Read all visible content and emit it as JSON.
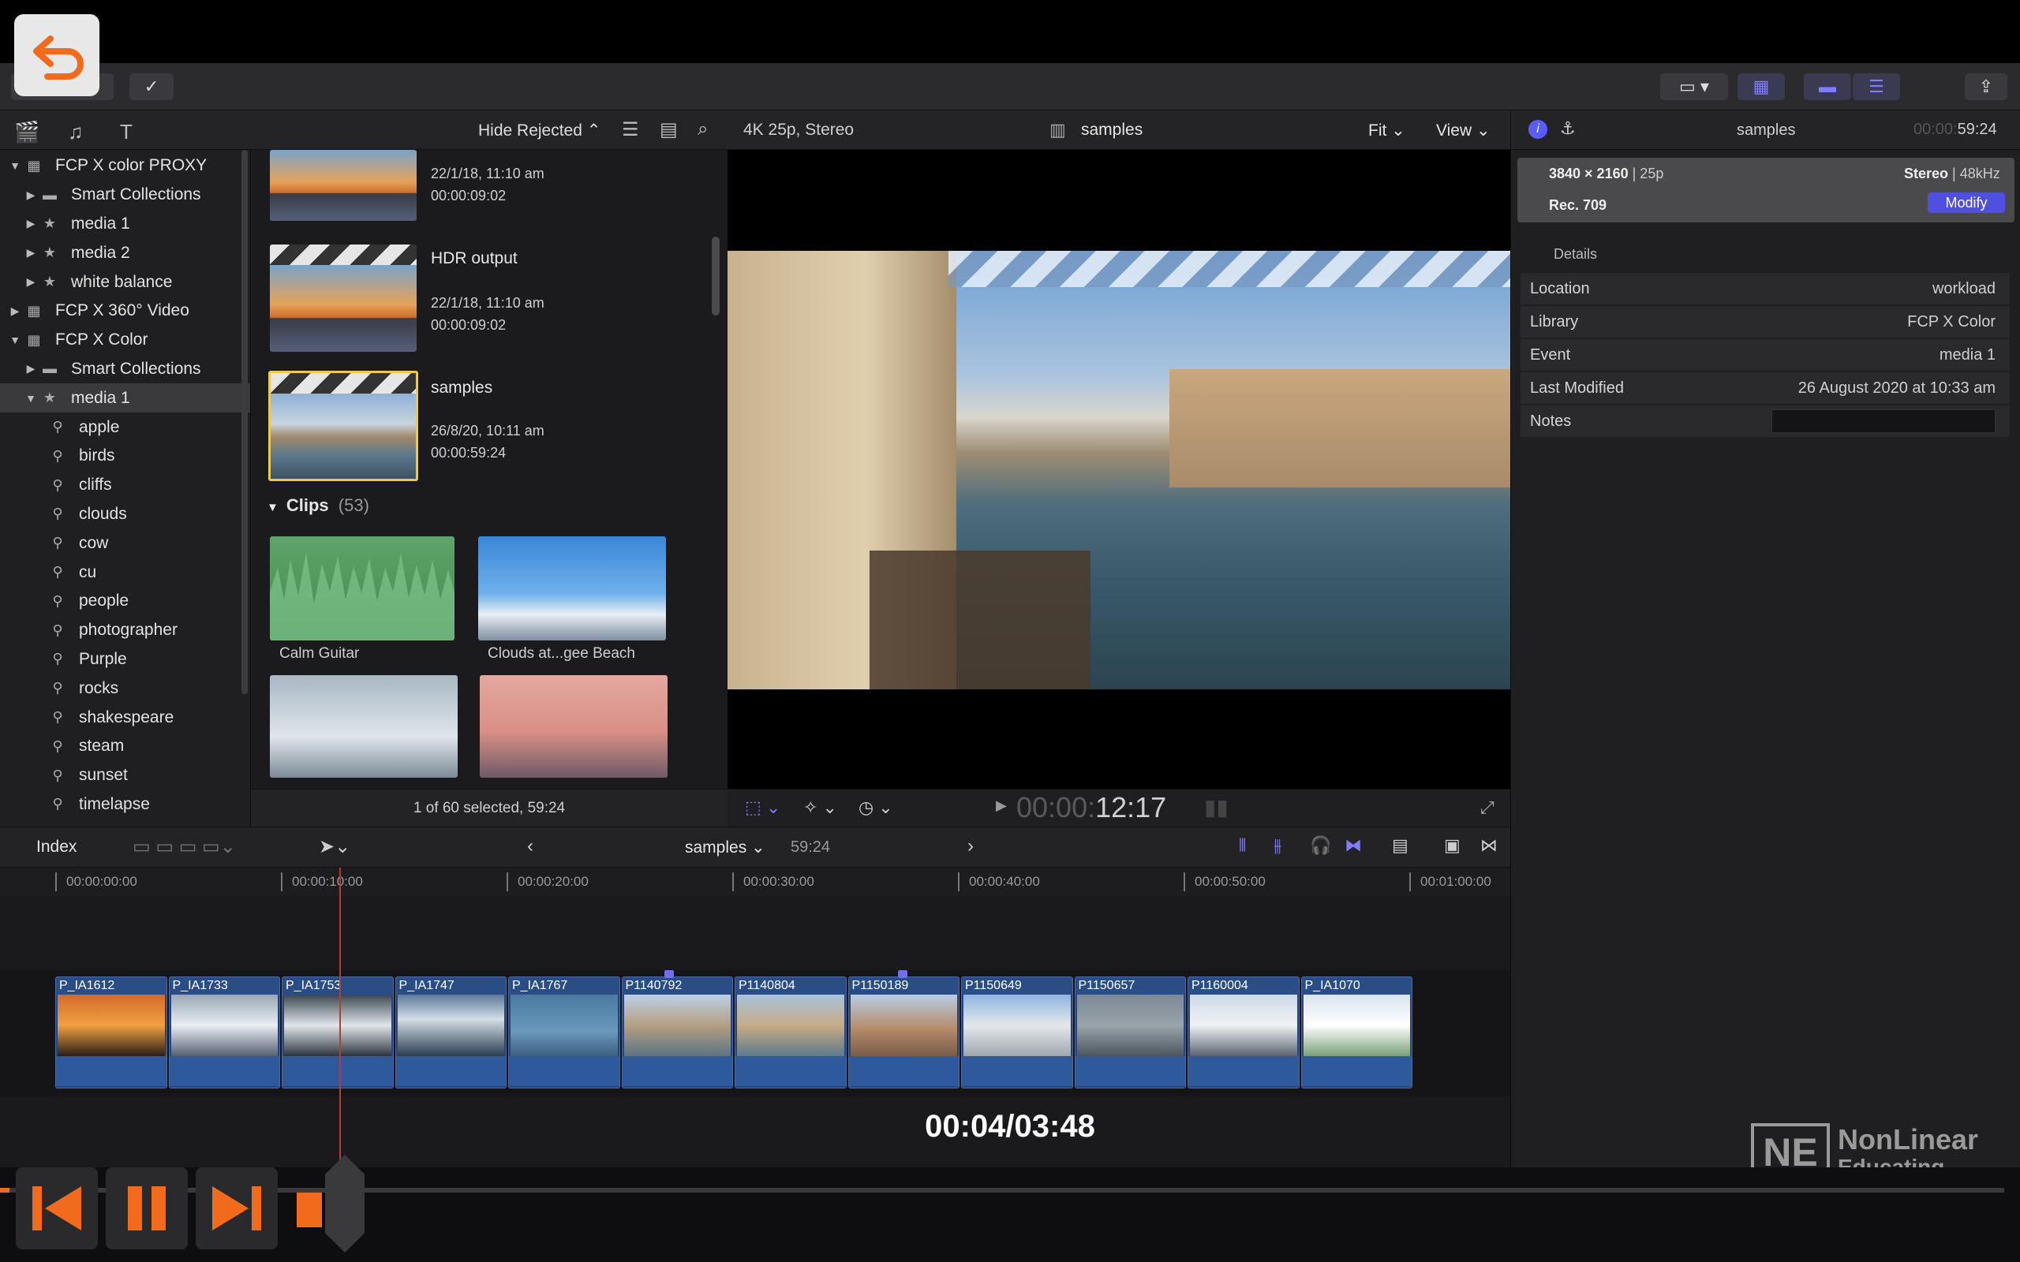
{
  "toolbar": {
    "back_icon": "undo-arrow-icon",
    "check_icon": "checkmark-icon"
  },
  "browser": {
    "filter_label": "Hide Rejected",
    "top_clip": {
      "date": "22/1/18, 11:10 am",
      "duration": "00:00:09:02"
    },
    "hdr_clip": {
      "name": "HDR output",
      "date": "22/1/18, 11:10 am",
      "duration": "00:00:09:02"
    },
    "samples_clip": {
      "name": "samples",
      "date": "26/8/20, 10:11 am",
      "duration": "00:00:59:24"
    },
    "clips_header": "Clips",
    "clips_count": "(53)",
    "clips": [
      "Calm Guitar",
      "Clouds at...gee Beach"
    ],
    "status": "1 of 60 selected, 59:24"
  },
  "library": {
    "items": [
      {
        "label": "FCP X color PROXY",
        "level": 0,
        "tri": "▼",
        "icon": "library-icon"
      },
      {
        "label": "Smart Collections",
        "level": 1,
        "tri": "▶",
        "icon": "folder-icon"
      },
      {
        "label": "media 1",
        "level": 1,
        "tri": "▶",
        "icon": "event-icon"
      },
      {
        "label": "media 2",
        "level": 1,
        "tri": "▶",
        "icon": "event-icon"
      },
      {
        "label": "white balance",
        "level": 1,
        "tri": "▶",
        "icon": "event-icon"
      },
      {
        "label": "FCP X 360° Video",
        "level": 0,
        "tri": "▶",
        "icon": "library-icon"
      },
      {
        "label": "FCP X Color",
        "level": 0,
        "tri": "▼",
        "icon": "library-icon"
      },
      {
        "label": "Smart Collections",
        "level": 1,
        "tri": "▶",
        "icon": "folder-icon"
      },
      {
        "label": "media 1",
        "level": 1,
        "tri": "▼",
        "icon": "event-icon",
        "selected": true
      },
      {
        "label": "apple",
        "level": 2,
        "icon": "keyword-icon"
      },
      {
        "label": "birds",
        "level": 2,
        "icon": "keyword-icon"
      },
      {
        "label": "cliffs",
        "level": 2,
        "icon": "keyword-icon"
      },
      {
        "label": "clouds",
        "level": 2,
        "icon": "keyword-icon"
      },
      {
        "label": "cow",
        "level": 2,
        "icon": "keyword-icon"
      },
      {
        "label": "cu",
        "level": 2,
        "icon": "keyword-icon"
      },
      {
        "label": "people",
        "level": 2,
        "icon": "keyword-icon"
      },
      {
        "label": "photographer",
        "level": 2,
        "icon": "keyword-icon"
      },
      {
        "label": "Purple",
        "level": 2,
        "icon": "keyword-icon"
      },
      {
        "label": "rocks",
        "level": 2,
        "icon": "keyword-icon"
      },
      {
        "label": "shakespeare",
        "level": 2,
        "icon": "keyword-icon"
      },
      {
        "label": "steam",
        "level": 2,
        "icon": "keyword-icon"
      },
      {
        "label": "sunset",
        "level": 2,
        "icon": "keyword-icon"
      },
      {
        "label": "timelapse",
        "level": 2,
        "icon": "keyword-icon"
      }
    ]
  },
  "viewer": {
    "format": "4K 25p, Stereo",
    "title": "samples",
    "fit": "Fit",
    "view": "View",
    "tc_dim": "00:00:",
    "tc_main": "12:17"
  },
  "inspector": {
    "title": "samples",
    "tc_dim": "00:00:",
    "tc_main": "59:24",
    "resolution": "3840 × 2160",
    "rate": "| 25p",
    "audio": "Stereo",
    "audio_rate": "| 48kHz",
    "colorspace": "Rec. 709",
    "modify": "Modify",
    "section": "Details",
    "details": [
      {
        "label": "Location",
        "value": "workload"
      },
      {
        "label": "Library",
        "value": "FCP X Color"
      },
      {
        "label": "Event",
        "value": "media 1"
      },
      {
        "label": "Last Modified",
        "value": "26 August 2020 at 10:33 am"
      },
      {
        "label": "Notes",
        "value": ""
      }
    ]
  },
  "timeline": {
    "index": "Index",
    "project": "samples",
    "duration": "59:24",
    "ruler": [
      "00:00:00:00",
      "00:00:10:00",
      "00:00:20:00",
      "00:00:30:00",
      "00:00:40:00",
      "00:00:50:00",
      "00:01:00:00"
    ],
    "clips": [
      "P_IA1612",
      "P_IA1733",
      "P_IA1753",
      "P_IA1747",
      "P_IA1767",
      "P1140792",
      "P1140804",
      "P1150189",
      "P1150649",
      "P1150657",
      "P1160004",
      "P_IA1070"
    ]
  },
  "player": {
    "time": "00:04/03:48",
    "logo_line1": "NonLinear",
    "logo_line2": "Educating Inc.",
    "logo_mark": "NE"
  }
}
